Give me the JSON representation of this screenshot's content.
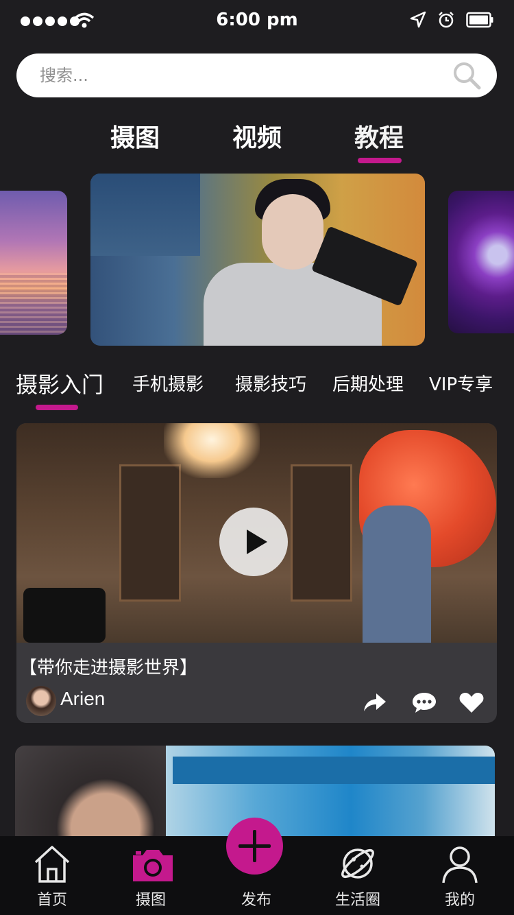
{
  "status_bar": {
    "time": "6:00 pm"
  },
  "search": {
    "placeholder": "搜索..."
  },
  "top_tabs": [
    {
      "label": "摄图",
      "active": false
    },
    {
      "label": "视频",
      "active": false
    },
    {
      "label": "教程",
      "active": true
    }
  ],
  "category_tabs": [
    {
      "label": "摄影入门",
      "active": true
    },
    {
      "label": "手机摄影",
      "active": false
    },
    {
      "label": "摄影技巧",
      "active": false
    },
    {
      "label": "后期处理",
      "active": false
    },
    {
      "label": "VIP专享",
      "active": false
    }
  ],
  "video_card": {
    "title": "【带你走进摄影世界】",
    "author": "Arien",
    "actions": [
      "share-icon",
      "comment-icon",
      "heart-icon"
    ]
  },
  "bottom_nav": [
    {
      "label": "首页",
      "icon": "home-icon",
      "active": false
    },
    {
      "label": "摄图",
      "icon": "camera-icon",
      "active": true
    },
    {
      "label": "发布",
      "icon": "plus-icon",
      "active": false
    },
    {
      "label": "生活圈",
      "icon": "planet-icon",
      "active": false
    },
    {
      "label": "我的",
      "icon": "user-icon",
      "active": false
    }
  ],
  "colors": {
    "accent": "#c4198d",
    "background": "#1e1d20",
    "card": "#3a393d"
  }
}
